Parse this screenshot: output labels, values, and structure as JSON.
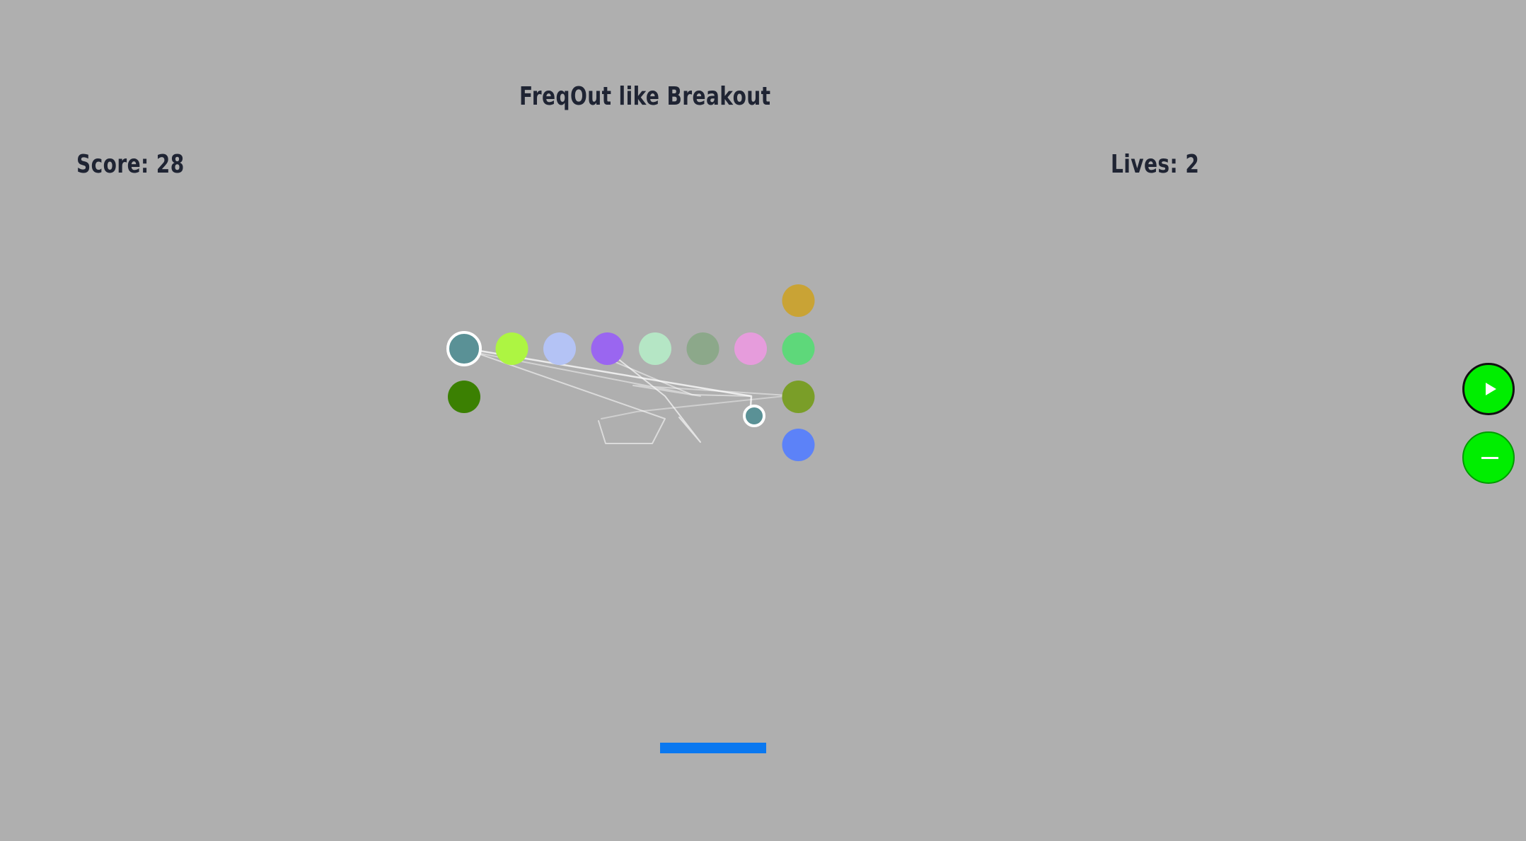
{
  "hud": {
    "title": "FreqOut like Breakout",
    "score_label": "Score: 28",
    "lives_label": "Lives: 2"
  },
  "colors": {
    "background": "#afafaf",
    "text": "#1f2433",
    "paddle": "#0a78f0",
    "ball": "#5a9196",
    "trail": "#ffffff",
    "button": "#00ee00"
  },
  "bricks": [
    {
      "row": 1,
      "col": 0,
      "color": "#5a9196",
      "highlighted": true
    },
    {
      "row": 1,
      "col": 1,
      "color": "#adf542"
    },
    {
      "row": 1,
      "col": 2,
      "color": "#b4c3f5"
    },
    {
      "row": 1,
      "col": 3,
      "color": "#9a66f0"
    },
    {
      "row": 1,
      "col": 4,
      "color": "#b5e6c5"
    },
    {
      "row": 1,
      "col": 5,
      "color": "#8ca88a"
    },
    {
      "row": 1,
      "col": 6,
      "color": "#e69cdc"
    },
    {
      "row": 0,
      "col": 7,
      "color": "#c9a335"
    },
    {
      "row": 1,
      "col": 7,
      "color": "#5ed87a"
    },
    {
      "row": 2,
      "col": 0,
      "color": "#3b8002"
    },
    {
      "row": 2,
      "col": 7,
      "color": "#7a9e28"
    },
    {
      "row": 3,
      "col": 7,
      "color": "#5c82f8"
    }
  ],
  "buttons": {
    "play_icon": "play-icon",
    "minus_icon": "minus-icon"
  }
}
